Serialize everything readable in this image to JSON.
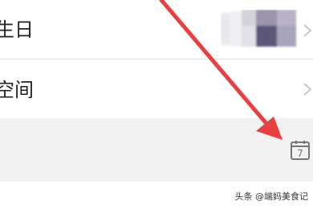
{
  "settings": {
    "rows": [
      {
        "label": "生日"
      },
      {
        "label": "空间"
      }
    ]
  },
  "watermark": {
    "text": "头条 @端妈美食记"
  },
  "icons": {
    "chevron": "chevron-right-icon",
    "calendar": "calendar-icon",
    "calendar_number": "7"
  },
  "colors": {
    "arrow": "#e84040",
    "calendar": "#777777",
    "chevron": "#c8c8cc"
  }
}
